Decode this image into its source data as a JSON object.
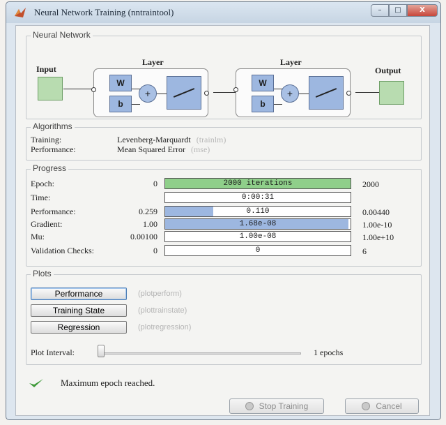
{
  "window": {
    "title": "Neural Network Training (nntraintool)",
    "min_symbol": "–",
    "max_symbol": "□",
    "close_symbol": "X"
  },
  "network": {
    "group_label": "Neural Network",
    "input_label": "Input",
    "output_label": "Output",
    "layers": [
      {
        "label": "Layer",
        "w": "W",
        "b": "b",
        "sum": "+"
      },
      {
        "label": "Layer",
        "w": "W",
        "b": "b",
        "sum": "+"
      }
    ]
  },
  "algorithms": {
    "group_label": "Algorithms",
    "training_key": "Training:",
    "training_value": "Levenberg-Marquardt",
    "training_fn": "(trainlm)",
    "performance_key": "Performance:",
    "performance_value": "Mean Squared Error",
    "performance_fn": "(mse)"
  },
  "progress": {
    "group_label": "Progress",
    "rows": [
      {
        "key": "Epoch:",
        "start": "0",
        "text": "2000 iterations",
        "end": "2000",
        "fill": 1.0,
        "color": "#8fcf8a"
      },
      {
        "key": "Time:",
        "start": "",
        "text": "0:00:31",
        "end": "",
        "fill": 0.0,
        "color": "#9db7e0"
      },
      {
        "key": "Performance:",
        "start": "0.259",
        "text": "0.110",
        "end": "0.00440",
        "fill": 0.26,
        "color": "#9db7e0"
      },
      {
        "key": "Gradient:",
        "start": "1.00",
        "text": "1.68e-08",
        "end": "1.00e-10",
        "fill": 0.99,
        "color": "#9db7e0"
      },
      {
        "key": "Mu:",
        "start": "0.00100",
        "text": "1.00e-08",
        "end": "1.00e+10",
        "fill": 0.0,
        "color": "#9db7e0"
      },
      {
        "key": "Validation Checks:",
        "start": "0",
        "text": "0",
        "end": "6",
        "fill": 0.0,
        "color": "#9db7e0"
      }
    ]
  },
  "plots": {
    "group_label": "Plots",
    "buttons": [
      {
        "label": "Performance",
        "fn": "(plotperform)"
      },
      {
        "label": "Training State",
        "fn": "(plottrainstate)"
      },
      {
        "label": "Regression",
        "fn": "(plotregression)"
      }
    ],
    "interval_label": "Plot Interval:",
    "interval_value": "1 epochs",
    "interval_level": 0.0
  },
  "status": {
    "message": "Maximum epoch reached."
  },
  "actions": {
    "stop_label": "Stop Training",
    "cancel_label": "Cancel"
  },
  "colors": {
    "epoch_fill": "#8fcf8a",
    "progress_fill": "#9db7e0",
    "check_green": "#3f9a3a"
  }
}
